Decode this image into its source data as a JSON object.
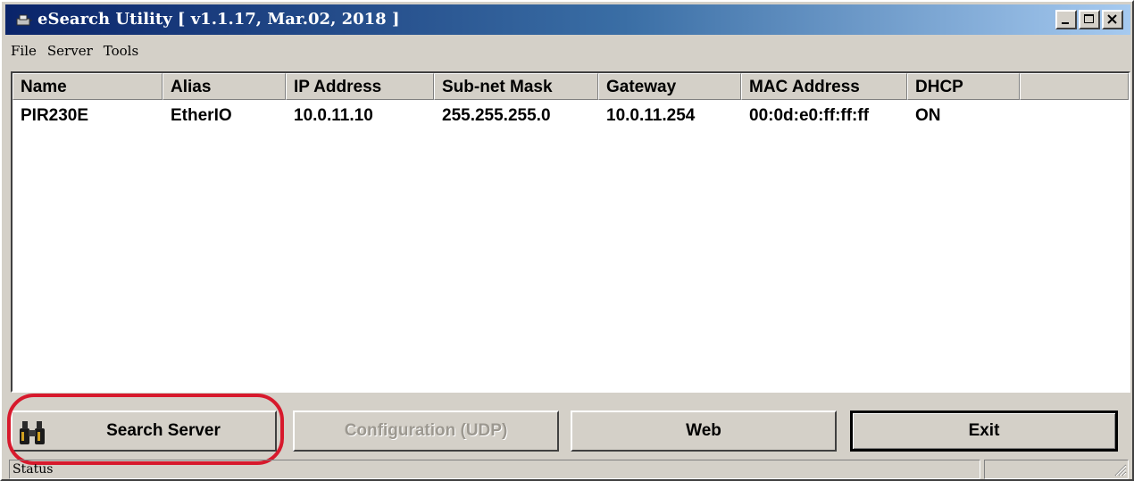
{
  "window": {
    "title": "eSearch Utility [ v1.1.17, Mar.02, 2018 ]"
  },
  "menu": [
    {
      "label": "File"
    },
    {
      "label": "Server"
    },
    {
      "label": "Tools"
    }
  ],
  "table": {
    "columns": [
      "Name",
      "Alias",
      "IP Address",
      "Sub-net Mask",
      "Gateway",
      "MAC Address",
      "DHCP",
      ""
    ],
    "rows": [
      [
        "PIR230E",
        "EtherIO",
        "10.0.11.10",
        "255.255.255.0",
        "10.0.11.254",
        "00:0d:e0:ff:ff:ff",
        "ON"
      ]
    ]
  },
  "buttons": {
    "search_server": "Search Server",
    "configuration": "Configuration (UDP)",
    "web": "Web",
    "exit": "Exit"
  },
  "status": {
    "label": "Status"
  },
  "icons": {
    "app": "app-icon",
    "search": "binoculars-icon",
    "minimize": "minimize-icon",
    "maximize": "maximize-icon",
    "close": "close-icon",
    "resize": "resize-grip-icon"
  },
  "colors": {
    "highlight": "#d7192c",
    "title_start": "#0a246a",
    "title_end": "#a6caf0",
    "face": "#d4d0c8"
  }
}
